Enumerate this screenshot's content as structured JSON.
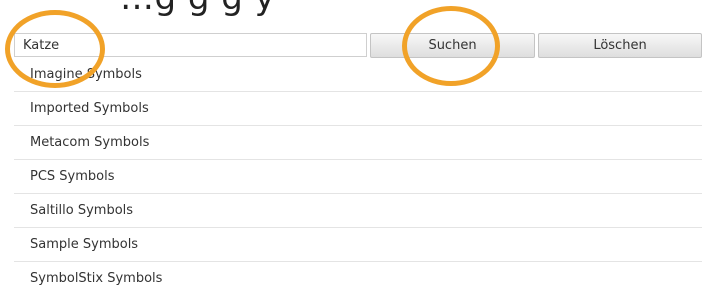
{
  "banner": {
    "text": "…g      g       g              y"
  },
  "search": {
    "value": "Katze",
    "search_label": "Suchen",
    "clear_label": "Löschen"
  },
  "collections": [
    {
      "label": "Imagine Symbols"
    },
    {
      "label": "Imported Symbols"
    },
    {
      "label": "Metacom Symbols"
    },
    {
      "label": "PCS Symbols"
    },
    {
      "label": "Saltillo Symbols"
    },
    {
      "label": "Sample Symbols"
    },
    {
      "label": "SymbolStix Symbols"
    }
  ],
  "colors": {
    "highlight": "#f1a228",
    "button_bg": "#e6e6e6",
    "divider": "#e4e4e4"
  }
}
